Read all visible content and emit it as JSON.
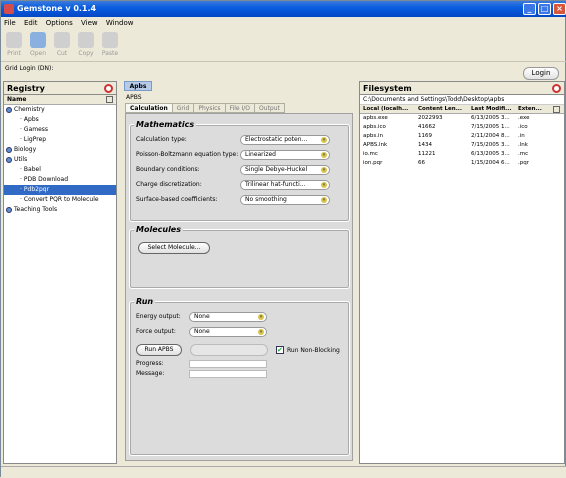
{
  "window": {
    "title": "Gemstone v 0.1.4",
    "min": "_",
    "max": "□",
    "close": "×"
  },
  "menu": [
    "File",
    "Edit",
    "Options",
    "View",
    "Window"
  ],
  "toolbar": [
    "Print",
    "Open",
    "Cut",
    "Copy",
    "Paste"
  ],
  "grid_login_label": "Grid Login (DN):",
  "login_button": "Login",
  "registry": {
    "title": "Registry",
    "column": "Name",
    "items": [
      {
        "label": "Chemistry",
        "level": 0,
        "ball": true
      },
      {
        "label": "Apbs",
        "level": 1
      },
      {
        "label": "Gamess",
        "level": 1
      },
      {
        "label": "LigPrep",
        "level": 1
      },
      {
        "label": "Biology",
        "level": 0,
        "ball": true
      },
      {
        "label": "Utils",
        "level": 0,
        "ball": true
      },
      {
        "label": "Babel",
        "level": 1
      },
      {
        "label": "PDB Download",
        "level": 1
      },
      {
        "label": "Pdb2pqr",
        "level": 1,
        "selected": true
      },
      {
        "label": "Convert PQR to Molecule",
        "level": 1
      },
      {
        "label": "Teaching Tools",
        "level": 0,
        "ball": true
      }
    ]
  },
  "apbs": {
    "tab": "Apbs",
    "header": "APBS",
    "tabs": [
      "Calculation",
      "Grid",
      "Physics",
      "File I/O",
      "Output"
    ],
    "mathematics": {
      "title": "Mathematics",
      "rows": [
        {
          "label": "Calculation type:",
          "value": "Electrostatic poten..."
        },
        {
          "label": "Poisson-Boltzmann equation type:",
          "value": "Linearized"
        },
        {
          "label": "Boundary conditions:",
          "value": "Single Debye-Huckel"
        },
        {
          "label": "Charge discretization:",
          "value": "Trilinear hat-functi..."
        },
        {
          "label": "Surface-based coefficients:",
          "value": "No smoothing"
        }
      ]
    },
    "molecules": {
      "title": "Molecules",
      "select_button": "Select Molecule..."
    },
    "run": {
      "title": "Run",
      "energy_label": "Energy output:",
      "energy_value": "None",
      "force_label": "Force output:",
      "force_value": "None",
      "run_button": "Run APBS",
      "nonblocking_label": "Run Non-Blocking",
      "progress_label": "Progress:",
      "message_label": "Message:"
    }
  },
  "filesystem": {
    "title": "Filesystem",
    "path": "C:\\Documents and Settings\\Todd\\Desktop\\apbs",
    "columns": [
      "Local (localh...",
      "Content Len...",
      "Last Modifi...",
      "Exten..."
    ],
    "rows": [
      [
        "apbs.exe",
        "2022993",
        "6/13/2005 3...",
        ".exe"
      ],
      [
        "apbs.ico",
        "41662",
        "7/15/2005 1...",
        ".ico"
      ],
      [
        "apbs.in",
        "1169",
        "2/11/2004 8...",
        ".in"
      ],
      [
        "APBS.lnk",
        "1434",
        "7/15/2005 3...",
        ".lnk"
      ],
      [
        "io.mc",
        "11221",
        "6/13/2005 3...",
        ".mc"
      ],
      [
        "ion.pqr",
        "66",
        "1/15/2004 6...",
        ".pqr"
      ]
    ]
  }
}
